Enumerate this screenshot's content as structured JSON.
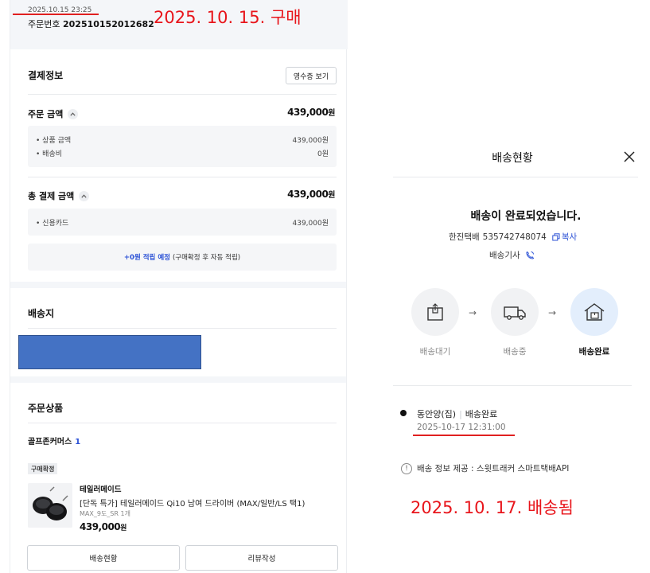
{
  "annotations": {
    "purchase": "2025. 10. 15. 구매",
    "delivered": "2025. 10. 17. 배송됨"
  },
  "order": {
    "datetime": "2025.10.15 23:25",
    "number_label": "주문번호",
    "number": "202510152012682"
  },
  "payment": {
    "title": "결제정보",
    "receipt_button": "영수증 보기",
    "order_amount_label": "주문 금액",
    "order_amount": "439,000",
    "currency": "원",
    "order_breakdown": [
      {
        "label": "• 상품 금액",
        "value": "439,000원"
      },
      {
        "label": "• 배송비",
        "value": "0원"
      }
    ],
    "total_label": "총 결제 금액",
    "total_amount": "439,000",
    "total_breakdown": [
      {
        "label": "• 신용카드",
        "value": "439,000원"
      }
    ],
    "points_highlight": "+0원 적립 예정",
    "points_note": "(구매확정 후 자동 적립)"
  },
  "shipping_address": {
    "title": "배송지"
  },
  "order_items": {
    "title": "주문상품",
    "seller": "골프존커머스",
    "seller_count": "1",
    "status_badge": "구매확정",
    "brand": "테일러메이드",
    "product_name": "[단독 특가] 테일러메이드 Qi10 남여 드라이버 (MAX/일반/LS 택1)",
    "option": "MAX_9도_SR 1개",
    "price": "439,000",
    "currency": "원",
    "track_button": "배송현황",
    "review_button": "리뷰작성"
  },
  "delivery_status": {
    "title": "배송현황",
    "status_title": "배송이 완료되었습니다.",
    "carrier": "한진택배",
    "tracking_number": "535742748074",
    "copy_label": "복사",
    "driver_label": "배송기사",
    "steps": [
      {
        "label": "배송대기",
        "icon": "box-icon"
      },
      {
        "label": "배송중",
        "icon": "truck-icon"
      },
      {
        "label": "배송완료",
        "icon": "house-package-icon"
      }
    ],
    "arrow": "→",
    "location": "동안양(집)",
    "location_status": "배송완료",
    "location_time": "2025-10-17 12:31:00",
    "info_text": "배송 정보 제공 : 스윗트래커 스마트택배API"
  },
  "colors": {
    "annotation_red": "#e8151b",
    "accent_blue": "#2c52d6",
    "redaction_blue": "#4472c4",
    "active_step_bg": "#e3eefc"
  }
}
